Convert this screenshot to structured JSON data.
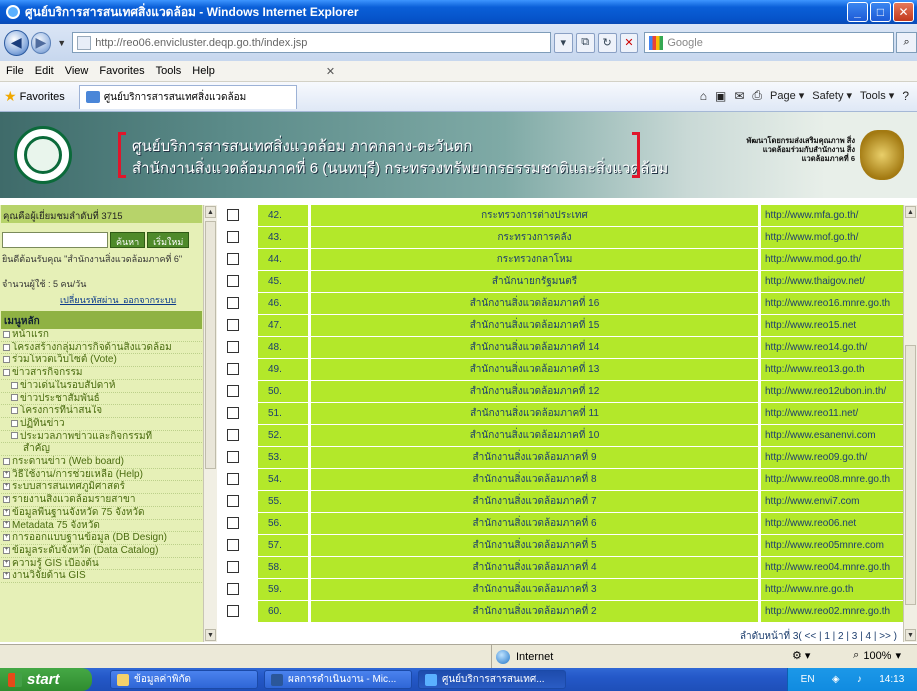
{
  "window": {
    "title": "ศูนย์บริการสารสนเทศสิ่งแวดล้อม - Windows Internet Explorer",
    "controls": [
      "_",
      "□",
      "✕"
    ]
  },
  "address_bar": {
    "url": "http://reo06.envicluster.deqp.go.th/index.jsp",
    "search_placeholder": "Google"
  },
  "menu": [
    "File",
    "Edit",
    "View",
    "Favorites",
    "Tools",
    "Help"
  ],
  "favorites_bar": {
    "favorites_label": "Favorites",
    "tab_title": "ศูนย์บริการสารสนเทศสิ่งแวดล้อม",
    "commands": [
      "Page ▾",
      "Safety ▾",
      "Tools ▾"
    ]
  },
  "banner": {
    "line1": "ศูนย์บริการสารสนเทศสิ่งแวดล้อม ภาคกลาง-ตะวันตก",
    "line2": "สำนักงานสิ่งแวดล้อมภาคที่ 6 (นนทบุรี) กระทรวงทรัพยากรธรรมชาติและสิ่งแวดล้อม",
    "right_text": "พัฒนาโดยกรมส่งเสริมคุณภาพ สิ่งแวดล้อมร่วมกับสำนักงาน สิ่งแวดล้อมภาคที่ 6"
  },
  "sidebar": {
    "visitors": "คุณคือผู้เยี่ยมชมลำดับที่ 3715",
    "search_button": "ค้นหา",
    "reset_button": "เริ่มใหม่",
    "welcome": "ยินดีต้อนรับคุณ \"สำนักงานสิ่งแวดล้อมภาคที่ 6\"",
    "count": "จำนวนผู้ใช้ : 5 คน/วัน",
    "change_password": "เปลี่ยนรหัสผ่าน",
    "logout": "ออกจากระบบ",
    "menu_title": "เมนูหลัก",
    "menu_items": [
      {
        "label": "หน้าแรก",
        "level": 0
      },
      {
        "label": "โครงสร้างกลุ่มภารกิจด้านสิ่งแวดล้อม",
        "level": 0
      },
      {
        "label": "ร่วมโหวตเว็บไซต์ (Vote)",
        "level": 0
      },
      {
        "label": "ข่าวสารกิจกรรม",
        "level": 0
      },
      {
        "label": "ข่าวเด่นในรอบสัปดาห์",
        "level": 1
      },
      {
        "label": "ข่าวประชาสัมพันธ์",
        "level": 1
      },
      {
        "label": "โครงการที่น่าสนใจ",
        "level": 1
      },
      {
        "label": "ปฏิทินข่าว",
        "level": 1
      },
      {
        "label": "ประมวลภาพข่าวและกิจกรรมที่",
        "level": 1
      },
      {
        "label": "สำคัญ",
        "level": 2
      },
      {
        "label": "กระดานข่าว (Web board)",
        "level": 0
      },
      {
        "label": "วิธีใช้งาน/การช่วยเหลือ (Help)",
        "level": 0
      },
      {
        "label": "ระบบสารสนเทศภูมิศาสตร์",
        "level": 0
      },
      {
        "label": "รายงานสิ่งแวดล้อมรายสาขา",
        "level": 0
      },
      {
        "label": "ข้อมูลพื้นฐานจังหวัด 75 จังหวัด",
        "level": 0
      },
      {
        "label": "Metadata 75 จังหวัด",
        "level": 0
      },
      {
        "label": "การออกแบบฐานข้อมูล (DB Design)",
        "level": 0
      },
      {
        "label": "ข้อมูลระดับจังหวัด (Data Catalog)",
        "level": 0
      },
      {
        "label": "ความรู้ GIS เบื้องต้น",
        "level": 0
      },
      {
        "label": "งานวิจัยด้าน GIS",
        "level": 0
      }
    ]
  },
  "table": {
    "rows": [
      {
        "no": "42.",
        "name": "กระทรวงการต่างประเทศ",
        "url": "http://www.mfa.go.th/"
      },
      {
        "no": "43.",
        "name": "กระทรวงการคลัง",
        "url": "http://www.mof.go.th/"
      },
      {
        "no": "44.",
        "name": "กระทรวงกลาโหม",
        "url": "http://www.mod.go.th/"
      },
      {
        "no": "45.",
        "name": "สำนักนายกรัฐมนตรี",
        "url": "http://www.thaigov.net/"
      },
      {
        "no": "46.",
        "name": "สำนักงานสิ่งแวดล้อมภาคที่ 16",
        "url": "http://www.reo16.mnre.go.th"
      },
      {
        "no": "47.",
        "name": "สำนักงานสิ่งแวดล้อมภาคที่ 15",
        "url": "http://www.reo15.net"
      },
      {
        "no": "48.",
        "name": "สำนักงานสิ่งแวดล้อมภาคที่ 14",
        "url": "http://www.reo14.go.th/"
      },
      {
        "no": "49.",
        "name": "สำนักงานสิ่งแวดล้อมภาคที่ 13",
        "url": "http://www.reo13.go.th"
      },
      {
        "no": "50.",
        "name": "สำนักงานสิ่งแวดล้อมภาคที่ 12",
        "url": "http://www.reo12ubon.in.th/"
      },
      {
        "no": "51.",
        "name": "สำนักงานสิ่งแวดล้อมภาคที่ 11",
        "url": "http://www.reo11.net/"
      },
      {
        "no": "52.",
        "name": "สำนักงานสิ่งแวดล้อมภาคที่ 10",
        "url": "http://www.esanenvi.com"
      },
      {
        "no": "53.",
        "name": "สำนักงานสิ่งแวดล้อมภาคที่ 9",
        "url": "http://www.reo09.go.th/"
      },
      {
        "no": "54.",
        "name": "สำนักงานสิ่งแวดล้อมภาคที่ 8",
        "url": "http://www.reo08.mnre.go.th"
      },
      {
        "no": "55.",
        "name": "สำนักงานสิ่งแวดล้อมภาคที่ 7",
        "url": "http://www.envi7.com"
      },
      {
        "no": "56.",
        "name": "สำนักงานสิ่งแวดล้อมภาคที่ 6",
        "url": "http://www.reo06.net"
      },
      {
        "no": "57.",
        "name": "สำนักงานสิ่งแวดล้อมภาคที่ 5",
        "url": "http://www.reo05mnre.com"
      },
      {
        "no": "58.",
        "name": "สำนักงานสิ่งแวดล้อมภาคที่ 4",
        "url": "http://www.reo04.mnre.go.th"
      },
      {
        "no": "59.",
        "name": "สำนักงานสิ่งแวดล้อมภาคที่ 3",
        "url": "http://www.nre.go.th"
      },
      {
        "no": "60.",
        "name": "สำนักงานสิ่งแวดล้อมภาคที่ 2",
        "url": "http://www.reo02.mnre.go.th"
      }
    ],
    "pager": "ลำดับหน้าที่ 3( << | 1 | 2 | 3 | 4 | >> )"
  },
  "statusbar": {
    "zone": "Internet",
    "zoom": "100%"
  },
  "taskbar": {
    "start": "start",
    "tasks": [
      "ข้อมูลค่าพิกัด",
      "ผลการดำเนินงาน - Mic...",
      "ศูนย์บริการสารสนเทศ..."
    ],
    "lang": "EN",
    "clock": "14:13"
  },
  "colors": {
    "row_bg": "#b3e82a",
    "sidebar_bg": "#e6f0b7",
    "title_bar": "#0a5fd8"
  }
}
